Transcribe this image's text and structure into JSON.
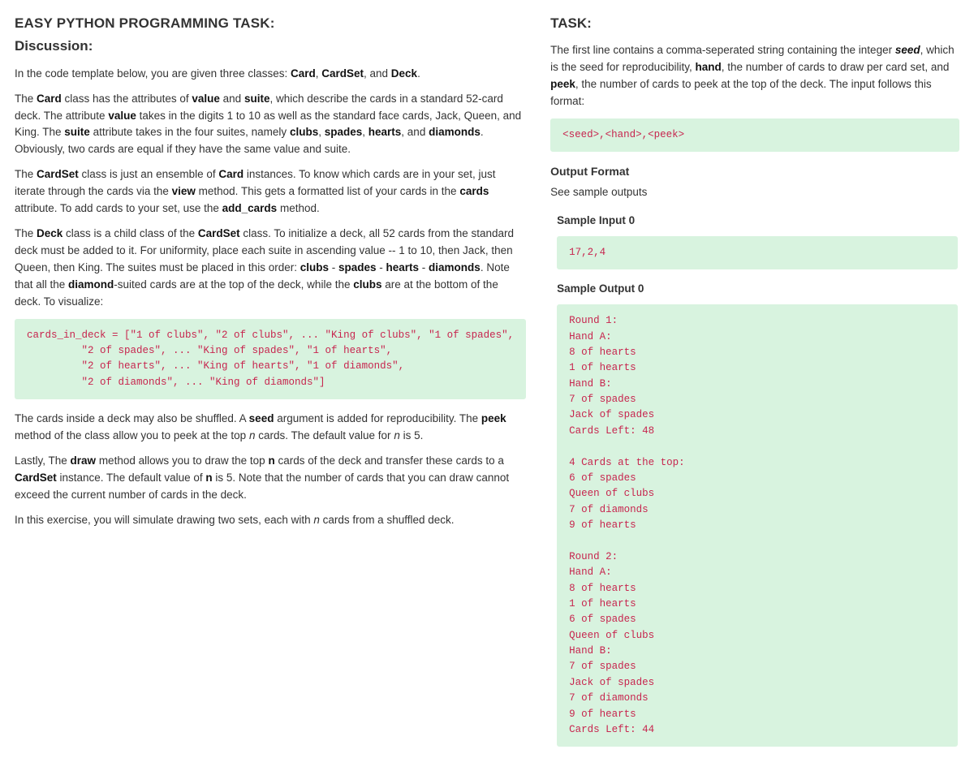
{
  "left": {
    "title": "EASY PYTHON PROGRAMMING TASK:",
    "subtitle": "Discussion:",
    "intro_html": "In the code template below, you are given three classes: <b>Card</b>, <b>CardSet</b>, and <b>Deck</b>.",
    "p_card_html": "The <b>Card</b> class has the attributes of <b>value</b> and <b>suite</b>, which describe the cards in a standard 52-card deck. The attribute <b>value</b> takes in the digits 1 to 10 as well as the standard face cards, Jack, Queen, and King. The <b>suite</b> attribute takes in the four suites, namely <b>clubs</b>, <b>spades</b>, <b>hearts</b>, and <b>diamonds</b>. Obviously, two cards are equal if they have the same value and suite.",
    "p_cardset_html": "The <b>CardSet</b> class is just an ensemble of <b>Card</b> instances. To know which cards are in your set, just iterate through the cards via the <b>view</b> method. This gets a formatted list of your cards in the <b>cards</b> attribute. To add cards to your set, use the <b>add_cards</b> method.",
    "p_deck_html": "The <b>Deck</b> class is a child class of the <b>CardSet</b> class. To initialize a deck, all 52 cards from the standard deck must be added to it. For uniformity, place each suite in ascending value -- 1 to 10, then Jack, then Queen, then King. The suites must be placed in this order: <b>clubs</b> - <b>spades</b> - <b>hearts</b> - <b>diamonds</b>. Note that all the <b>diamond</b>-suited cards are at the top of the deck, while the <b>clubs</b> are at the bottom of the deck. To visualize:",
    "code_cards": "cards_in_deck = [\"1 of clubs\", \"2 of clubs\", ... \"King of clubs\", \"1 of spades\",\n         \"2 of spades\", ... \"King of spades\", \"1 of hearts\",\n         \"2 of hearts\", ... \"King of hearts\", \"1 of diamonds\",\n         \"2 of diamonds\", ... \"King of diamonds\"]",
    "p_shuffle_html": "The cards inside a deck may also be shuffled. A <b>seed</b> argument is added for reproducibility. The <b>peek</b> method of the class allow you to peek at the top <i>n</i> cards. The default value for <i>n</i> is 5.",
    "p_draw_html": "Lastly, The <b>draw</b> method allows you to draw the top <b>n</b> cards of the deck and transfer these cards to a <b>CardSet</b> instance. The default value of <b>n</b> is 5. Note that the number of cards that you can draw cannot exceed the current number of cards in the deck.",
    "p_exercise_html": "In this exercise, you will simulate drawing two sets, each with <i>n</i> cards from a shuffled deck."
  },
  "right": {
    "title": "TASK:",
    "intro_html": "The first line contains a comma-seperated string containing the integer <b><i>seed</i></b>, which is the seed for reproducibility, <b>hand</b>, the number of cards to draw per card set, and <b>peek</b>, the number of cards to peek at the top of the deck. The input follows this format:",
    "code_format": "<seed>,<hand>,<peek>",
    "output_format_heading": "Output Format",
    "output_format_text": "See sample outputs",
    "sample_input_heading": "Sample Input 0",
    "sample_input": "17,2,4",
    "sample_output_heading": "Sample Output 0",
    "sample_output": "Round 1:\nHand A:\n8 of hearts\n1 of hearts\nHand B:\n7 of spades\nJack of spades\nCards Left: 48\n\n4 Cards at the top:\n6 of spades\nQueen of clubs\n7 of diamonds\n9 of hearts\n\nRound 2:\nHand A:\n8 of hearts\n1 of hearts\n6 of spades\nQueen of clubs\nHand B:\n7 of spades\nJack of spades\n7 of diamonds\n9 of hearts\nCards Left: 44"
  }
}
